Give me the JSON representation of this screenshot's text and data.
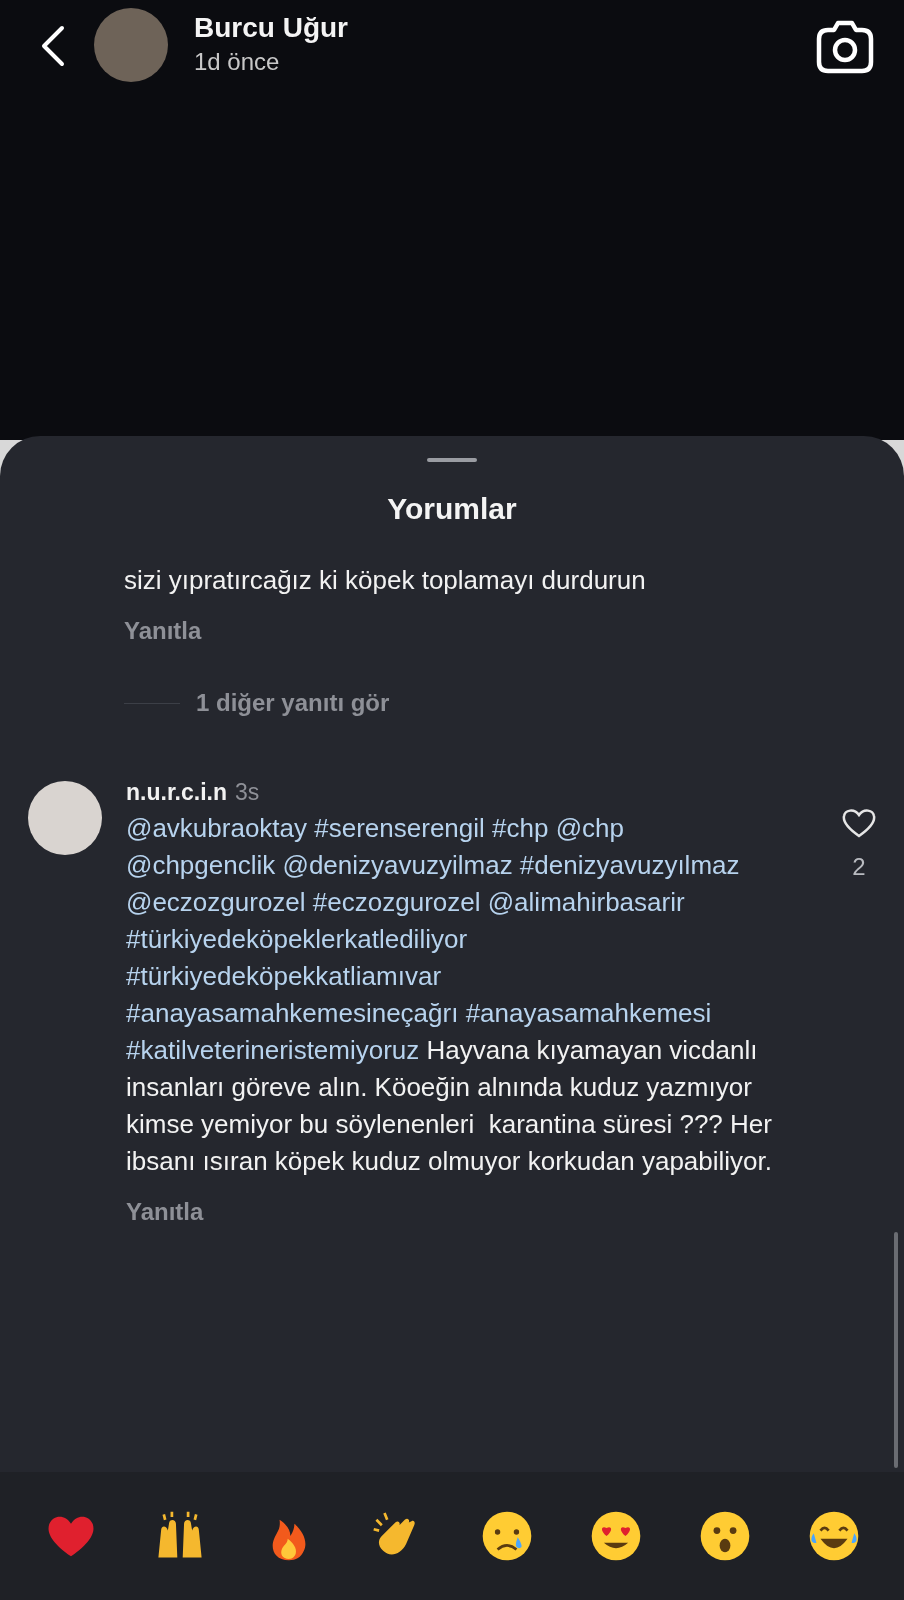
{
  "header": {
    "name": "Burcu Uğur",
    "time": "1d önce"
  },
  "sheet": {
    "title": "Yorumlar"
  },
  "comments": [
    {
      "kind": "partial",
      "body": [
        {
          "kind": "text",
          "text": "sizi yıpratırcağız ki köpek toplamayı durdurun"
        }
      ],
      "reply": "Yanıtla",
      "more_replies": "1 diğer yanıtı gör"
    },
    {
      "kind": "full",
      "username": "n.u.r.c.i.n",
      "time": "3s",
      "likes": "2",
      "liked": false,
      "body": [
        {
          "kind": "link",
          "text": "@avkubraoktay"
        },
        {
          "kind": "link",
          "text": "#serenserengil"
        },
        {
          "kind": "link",
          "text": "#chp"
        },
        {
          "kind": "link",
          "text": "@chp"
        },
        {
          "kind": "link",
          "text": "@chpgenclik"
        },
        {
          "kind": "link",
          "text": "@denizyavuzyilmaz"
        },
        {
          "kind": "link",
          "text": "#denizyavuzyılmaz"
        },
        {
          "kind": "link",
          "text": "@eczozgurozel"
        },
        {
          "kind": "link",
          "text": "#eczozgurozel"
        },
        {
          "kind": "link",
          "text": "@alimahirbasarir"
        },
        {
          "kind": "link",
          "text": "#türkiyedeköpeklerkatlediliyor"
        },
        {
          "kind": "link",
          "text": "#türkiyedeköpekkatliamıvar"
        },
        {
          "kind": "link",
          "text": "#anayasamahkemesineçağrı"
        },
        {
          "kind": "link",
          "text": "#anayasamahkemesi"
        },
        {
          "kind": "link",
          "text": "#katilveterineristemiyoruz"
        },
        {
          "kind": "text",
          "text": "Hayvana kıyamayan vicdanlı insanları göreve alın. Köoeğin alnında kuduz yazmıyor kimse yemiyor bu söylenenleri  karantina süresi ??? Her ibsanı ısıran köpek kuduz olmuyor korkudan yapabiliyor."
        }
      ],
      "reply": "Yanıtla"
    }
  ],
  "reactions": [
    {
      "kind": "heart"
    },
    {
      "kind": "raised-hands"
    },
    {
      "kind": "fire"
    },
    {
      "kind": "clap"
    },
    {
      "kind": "cry"
    },
    {
      "kind": "heart-eyes"
    },
    {
      "kind": "surprised"
    },
    {
      "kind": "laugh"
    }
  ]
}
